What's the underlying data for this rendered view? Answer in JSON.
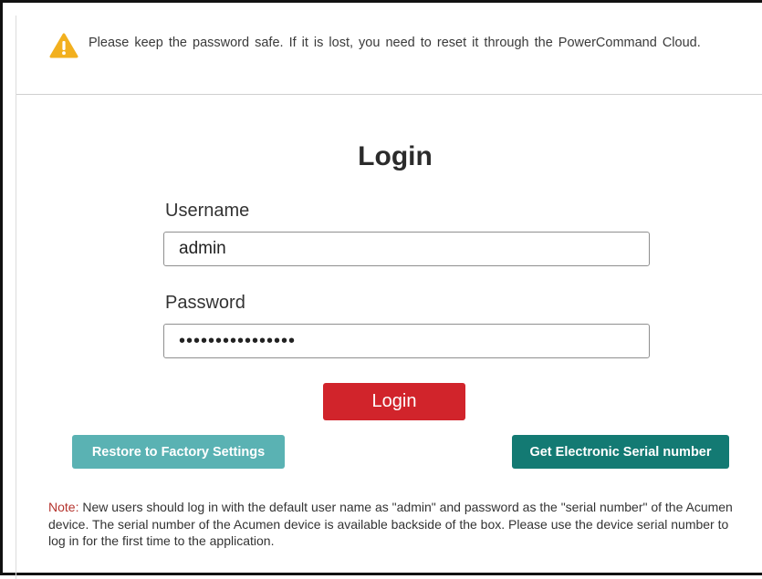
{
  "warning": {
    "icon": "warning-triangle-icon",
    "icon_color": "#f2b01e",
    "text": "Please keep the password safe. If it is lost, you need to reset it through the PowerCommand Cloud."
  },
  "login": {
    "title": "Login",
    "username_label": "Username",
    "username_value": "admin",
    "password_label": "Password",
    "password_value": "••••••••••••••••",
    "submit_label": "Login"
  },
  "actions": {
    "restore_label": "Restore to Factory Settings",
    "serial_label": "Get Electronic Serial number"
  },
  "note": {
    "label": "Note:",
    "text": " New users should log in with the default user name as \"admin\" and password as the \"serial number\" of the Acumen device. The serial number of the Acumen device is available backside of the box. Please use the device serial number to log in for the first time to the application."
  },
  "colors": {
    "login_button": "#d1242b",
    "restore_button": "#5ab2b3",
    "serial_button": "#137a73",
    "note_label": "#b5342e"
  }
}
